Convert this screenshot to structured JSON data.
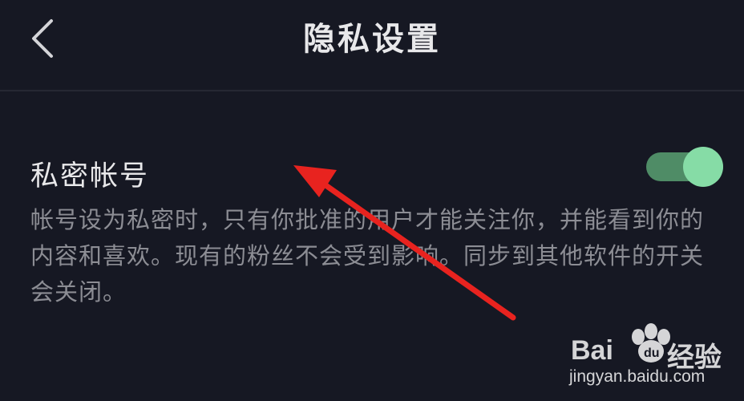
{
  "header": {
    "title": "隐私设置",
    "back_icon": "chevron-left-icon"
  },
  "setting": {
    "label": "私密帐号",
    "toggle_state": "on",
    "description": "帐号设为私密时，只有你批准的用户才能关注你，并能看到你的内容和喜欢。现有的粉丝不会受到影响。同步到其他软件的开关会关闭。"
  },
  "watermark": {
    "brand": "Bai",
    "brand_suffix": "经验",
    "url": "jingyan.baidu.com"
  },
  "colors": {
    "background": "#161823",
    "toggle_track": "#4f8c66",
    "toggle_knob": "#86dca6",
    "annotation_arrow": "#e8231f"
  }
}
